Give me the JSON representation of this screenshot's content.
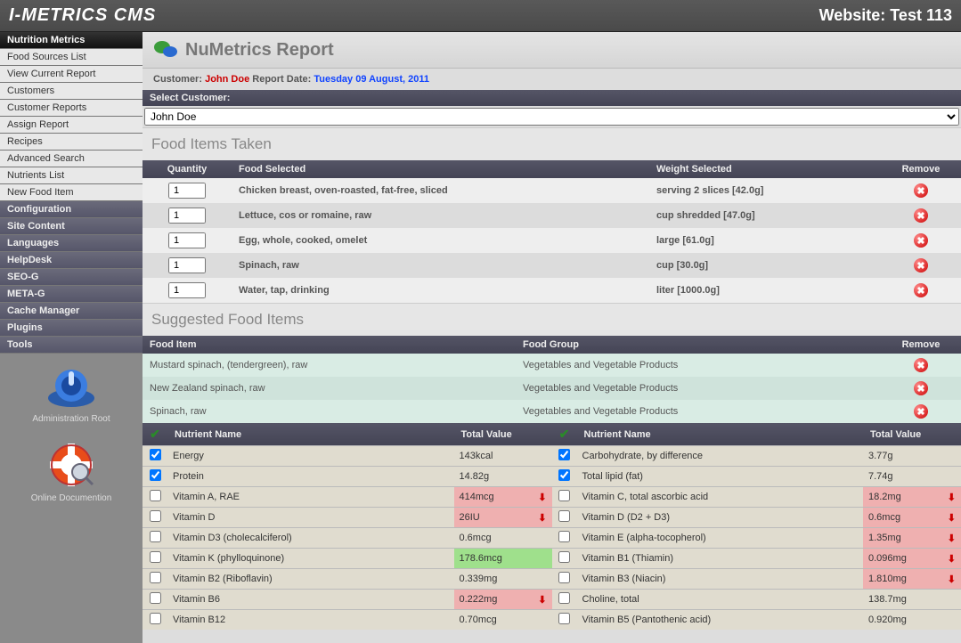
{
  "header": {
    "brand": "I-METRICS CMS",
    "site": "Website: Test 113"
  },
  "nav": {
    "active": "Nutrition Metrics",
    "items1": [
      "Food Sources List",
      "View Current Report",
      "Customers",
      "Customer Reports",
      "Assign Report",
      "Recipes",
      "Advanced Search",
      "Nutrients List",
      "New Food Item"
    ],
    "headers": [
      "Configuration",
      "Site Content",
      "Languages",
      "HelpDesk",
      "SEO-G",
      "META-G",
      "Cache Manager",
      "Plugins",
      "Tools"
    ],
    "admin_root": "Administration Root",
    "online_doc": "Online Documention"
  },
  "page": {
    "title": "NuMetrics Report",
    "customer_label": "Customer:",
    "customer_name": "John Doe",
    "report_label": "Report Date:",
    "report_date": "Tuesday 09 August, 2011",
    "select_customer_label": "Select Customer:",
    "select_customer_value": "John Doe"
  },
  "food_taken": {
    "title": "Food Items Taken",
    "cols": {
      "qty": "Quantity",
      "food": "Food Selected",
      "weight": "Weight Selected",
      "remove": "Remove"
    },
    "rows": [
      {
        "qty": "1",
        "food": "Chicken breast, oven-roasted, fat-free, sliced",
        "weight": "serving 2 slices [42.0g]"
      },
      {
        "qty": "1",
        "food": "Lettuce, cos or romaine, raw",
        "weight": "cup shredded [47.0g]"
      },
      {
        "qty": "1",
        "food": "Egg, whole, cooked, omelet",
        "weight": "large [61.0g]"
      },
      {
        "qty": "1",
        "food": "Spinach, raw",
        "weight": "cup [30.0g]"
      },
      {
        "qty": "1",
        "food": "Water, tap, drinking",
        "weight": "liter [1000.0g]"
      }
    ]
  },
  "suggested": {
    "title": "Suggested Food Items",
    "cols": {
      "item": "Food Item",
      "group": "Food Group",
      "remove": "Remove"
    },
    "rows": [
      {
        "item": "Mustard spinach, (tendergreen), raw",
        "group": "Vegetables and Vegetable Products"
      },
      {
        "item": "New Zealand spinach, raw",
        "group": "Vegetables and Vegetable Products"
      },
      {
        "item": "Spinach, raw",
        "group": "Vegetables and Vegetable Products"
      }
    ]
  },
  "nutrients": {
    "cols": {
      "name": "Nutrient Name",
      "val": "Total Value"
    },
    "left": [
      {
        "checked": true,
        "name": "Energy",
        "val": "143kcal",
        "status": "plain"
      },
      {
        "checked": true,
        "name": "Protein",
        "val": "14.82g",
        "status": "plain"
      },
      {
        "checked": false,
        "name": "Vitamin A, RAE",
        "val": "414mcg",
        "status": "red"
      },
      {
        "checked": false,
        "name": "Vitamin D",
        "val": "26IU",
        "status": "red"
      },
      {
        "checked": false,
        "name": "Vitamin D3 (cholecalciferol)",
        "val": "0.6mcg",
        "status": "plain"
      },
      {
        "checked": false,
        "name": "Vitamin K (phylloquinone)",
        "val": "178.6mcg",
        "status": "green"
      },
      {
        "checked": false,
        "name": "Vitamin B2 (Riboflavin)",
        "val": "0.339mg",
        "status": "plain"
      },
      {
        "checked": false,
        "name": "Vitamin B6",
        "val": "0.222mg",
        "status": "red"
      },
      {
        "checked": false,
        "name": "Vitamin B12",
        "val": "0.70mcg",
        "status": "plain"
      }
    ],
    "right": [
      {
        "checked": true,
        "name": "Carbohydrate, by difference",
        "val": "3.77g",
        "status": "plain"
      },
      {
        "checked": true,
        "name": "Total lipid (fat)",
        "val": "7.74g",
        "status": "plain"
      },
      {
        "checked": false,
        "name": "Vitamin C, total ascorbic acid",
        "val": "18.2mg",
        "status": "red"
      },
      {
        "checked": false,
        "name": "Vitamin D (D2 + D3)",
        "val": "0.6mcg",
        "status": "red"
      },
      {
        "checked": false,
        "name": "Vitamin E (alpha-tocopherol)",
        "val": "1.35mg",
        "status": "red"
      },
      {
        "checked": false,
        "name": "Vitamin B1 (Thiamin)",
        "val": "0.096mg",
        "status": "red"
      },
      {
        "checked": false,
        "name": "Vitamin B3 (Niacin)",
        "val": "1.810mg",
        "status": "red"
      },
      {
        "checked": false,
        "name": "Choline, total",
        "val": "138.7mg",
        "status": "plain"
      },
      {
        "checked": false,
        "name": "Vitamin B5 (Pantothenic acid)",
        "val": "0.920mg",
        "status": "plain"
      }
    ]
  }
}
